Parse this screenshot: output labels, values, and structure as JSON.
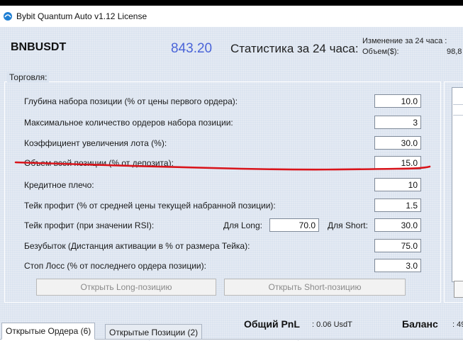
{
  "window": {
    "title": "Bybit Quantum Auto v1.12 License"
  },
  "header": {
    "symbol": "BNBUSDT",
    "price": "843.20",
    "stats_title": "Статистика за 24 часа:",
    "change_label": "Изменение за 24 часа :",
    "volume_label": "Объем($):",
    "volume_value": "98,8"
  },
  "trading": {
    "group_title": "Торговля:",
    "rows": [
      {
        "label": "Глубина набора позиции (% от цены первого ордера):",
        "value": "10.0"
      },
      {
        "label": "Максимальное количество ордеров набора позиции:",
        "value": "3"
      },
      {
        "label": "Коэффициент увеличения лота (%):",
        "value": "30.0"
      },
      {
        "label": "Объем всей позиции (% от депозита):",
        "value": "15.0"
      },
      {
        "label": "Кредитное плечо:",
        "value": "10"
      },
      {
        "label": "Тейк профит (% от средней цены текущей набранной позиции):",
        "value": "1.5"
      },
      {
        "label": "Тейк профит (при значении RSI):",
        "value": "30.0"
      },
      {
        "label": "Безубыток (Дистанция активации в % от размера Тейка):",
        "value": "75.0"
      },
      {
        "label": "Стоп Лосс (% от последнего ордера позиции):",
        "value": "3.0"
      }
    ],
    "rsi_long_label": "Для Long:",
    "rsi_long_value": "70.0",
    "rsi_short_label": "Для Short:",
    "open_long_label": "Открыть Long-позицию",
    "open_short_label": "Открыть Short-позицию"
  },
  "footer": {
    "pnl_label": "Общий PnL",
    "pnl_value": ": 0.06  UsdT",
    "balance_label": "Баланс",
    "balance_value": ": 49"
  },
  "tabs": [
    {
      "label": "Открытые Ордера (6)",
      "active": true
    },
    {
      "label": "Открытые Позиции (2)",
      "active": false
    }
  ],
  "colors": {
    "price": "#4a64d8",
    "annotation_line": "#d9141b",
    "background": "#dbe4f0"
  }
}
